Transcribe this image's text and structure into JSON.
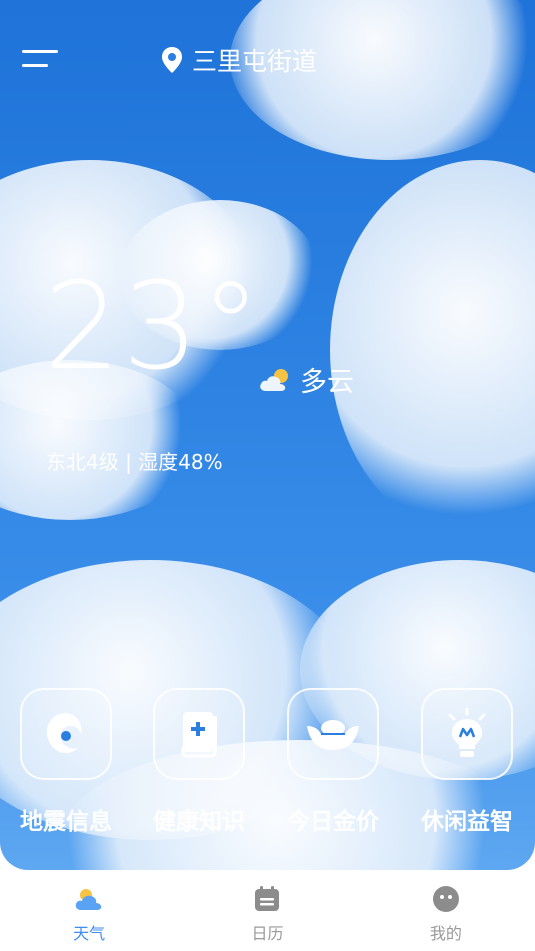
{
  "header": {
    "location": "三里屯街道"
  },
  "weather": {
    "temperature": "23°",
    "condition": "多云",
    "wind_humidity": "东北4级 | 湿度48%"
  },
  "tiles": [
    {
      "label": "地震信息",
      "icon": "typhoon-icon"
    },
    {
      "label": "健康知识",
      "icon": "medical-book-icon"
    },
    {
      "label": "今日金价",
      "icon": "gold-ingot-icon"
    },
    {
      "label": "休闲益智",
      "icon": "lightbulb-icon"
    }
  ],
  "tabs": [
    {
      "label": "天气",
      "icon": "weather-cloud-icon",
      "active": true
    },
    {
      "label": "日历",
      "icon": "calendar-icon",
      "active": false
    },
    {
      "label": "我的",
      "icon": "profile-face-icon",
      "active": false
    }
  ],
  "colors": {
    "accent": "#3f8cf0",
    "tab_inactive": "#9a9a9a",
    "sky": "#2a7fe0"
  }
}
